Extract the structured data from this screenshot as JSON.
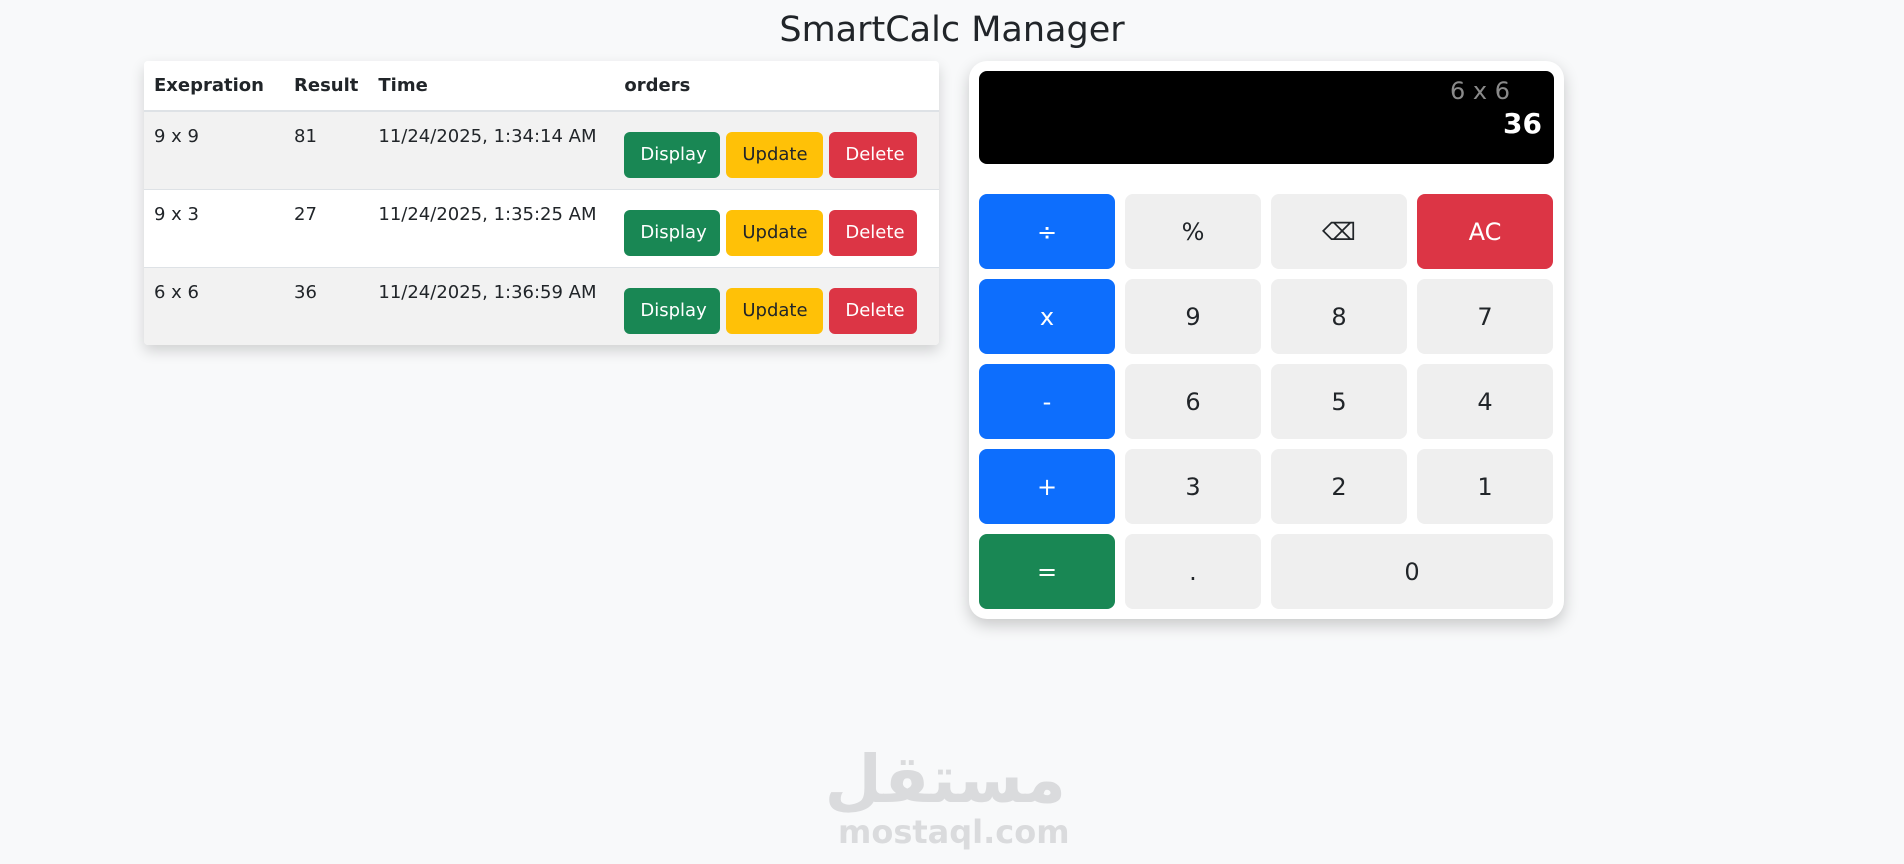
{
  "page": {
    "title": "SmartCalc Manager"
  },
  "history_table": {
    "headers": {
      "expression": "Exepration",
      "result": "Result",
      "time": "Time",
      "orders": "orders"
    },
    "rows": [
      {
        "expression": "9 x 9",
        "result": "81",
        "time": "11/24/2025, 1:34:14 AM"
      },
      {
        "expression": "9 x 3",
        "result": "27",
        "time": "11/24/2025, 1:35:25 AM"
      },
      {
        "expression": "6 x 6",
        "result": "36",
        "time": "11/24/2025, 1:36:59 AM"
      }
    ],
    "actions": {
      "display_label": "Display",
      "update_label": "Update",
      "delete_label": "Delete"
    }
  },
  "calculator": {
    "screen": {
      "expression": "6 x 6",
      "result": "36"
    },
    "keys": {
      "divide": "÷",
      "percent": "%",
      "backspace": "⌫",
      "clear": "AC",
      "multiply": "x",
      "nine": "9",
      "eight": "8",
      "seven": "7",
      "minus": "-",
      "six": "6",
      "five": "5",
      "four": "4",
      "plus": "+",
      "three": "3",
      "two": "2",
      "one": "1",
      "equals": "=",
      "decimal": ".",
      "zero": "0"
    }
  },
  "watermark": {
    "arabic": "مستقل",
    "latin": "mostaql.com"
  },
  "colors": {
    "primary": "#0d6efd",
    "success": "#198754",
    "warning": "#ffc107",
    "danger": "#dc3545",
    "key_bg": "#efefef",
    "screen_bg": "#000000"
  }
}
